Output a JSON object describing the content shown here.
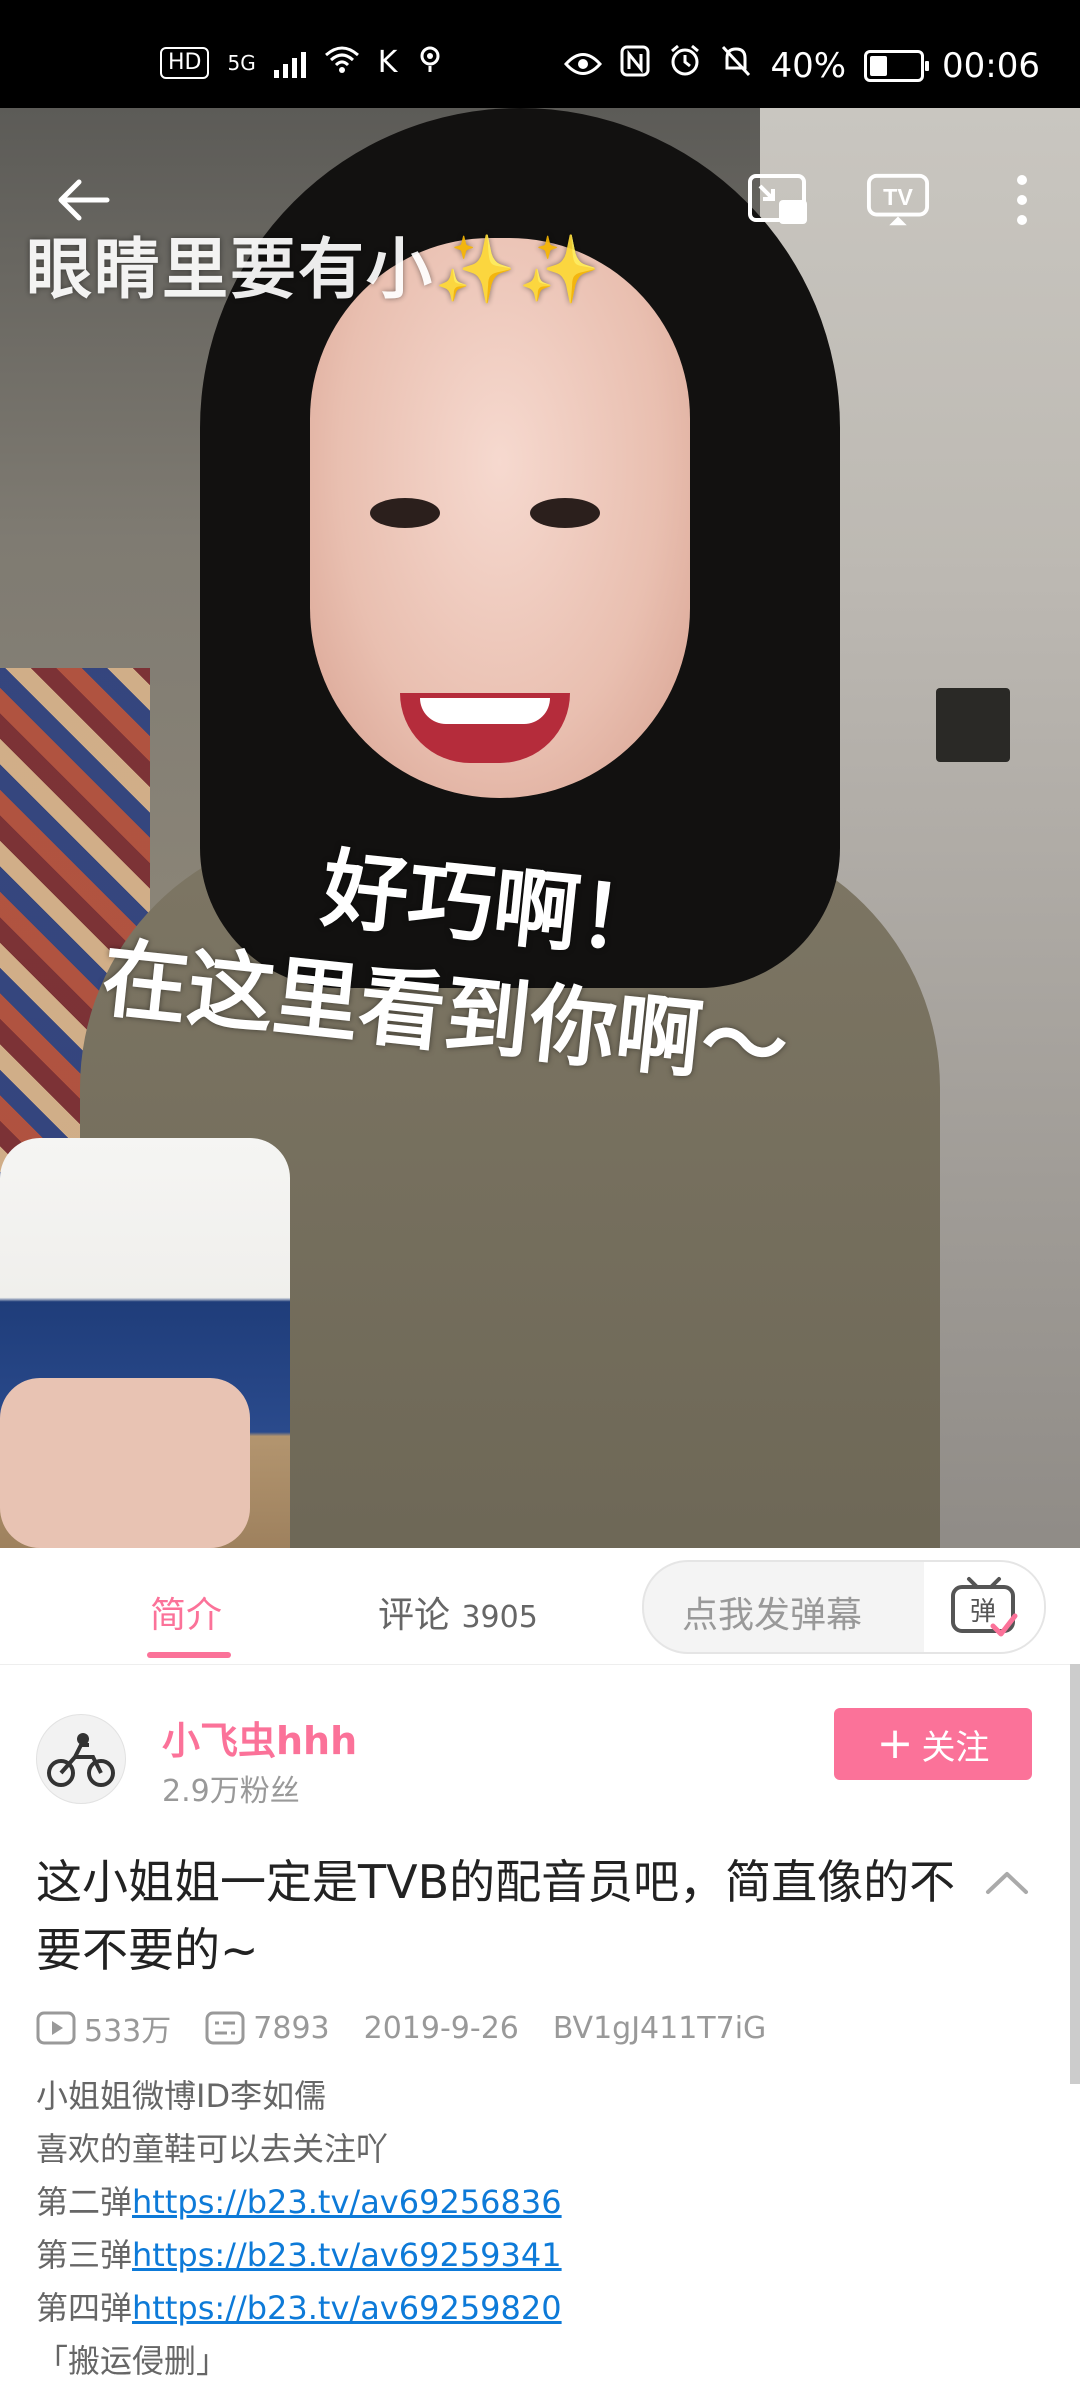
{
  "status_bar": {
    "left_badges": [
      "HD",
      "5G"
    ],
    "right": {
      "battery": "40%",
      "battery_level": 0.4,
      "time": "00:06"
    }
  },
  "video": {
    "overlay_captions": {
      "top": "眼睛里要有小",
      "middle_line1": "好巧啊！",
      "middle_line2": "在这里看到你啊～"
    },
    "controls": [
      "back-icon",
      "picture-in-picture-icon",
      "tv-cast-icon",
      "more-icon"
    ]
  },
  "tabs": {
    "intro": "简介",
    "comments": "评论",
    "comment_count": "3905",
    "danmaku_placeholder": "点我发弹幕",
    "danmaku_button": "弹"
  },
  "uploader": {
    "name": "小飞虫hhh",
    "fans": "2.9万粉丝",
    "follow_label": "关注"
  },
  "title": "这小姐姐一定是TVB的配音员吧，简直像的不要不要的~",
  "meta": {
    "views": "533万",
    "danmaku_count": "7893",
    "date": "2019-9-26",
    "bvid": "BV1gJ411T7iG"
  },
  "description": {
    "line1": "小姐姐微博ID李如儒",
    "line2": "喜欢的童鞋可以去关注吖",
    "links": [
      {
        "prefix": "第二弹",
        "url": "https://b23.tv/av69256836"
      },
      {
        "prefix": "第三弹",
        "url": "https://b23.tv/av69259341"
      },
      {
        "prefix": "第四弹",
        "url": "https://b23.tv/av69259820"
      }
    ],
    "tag": "「搬运侵删」"
  },
  "colors": {
    "accent": "#fb7299",
    "link": "#0d7ad8"
  }
}
